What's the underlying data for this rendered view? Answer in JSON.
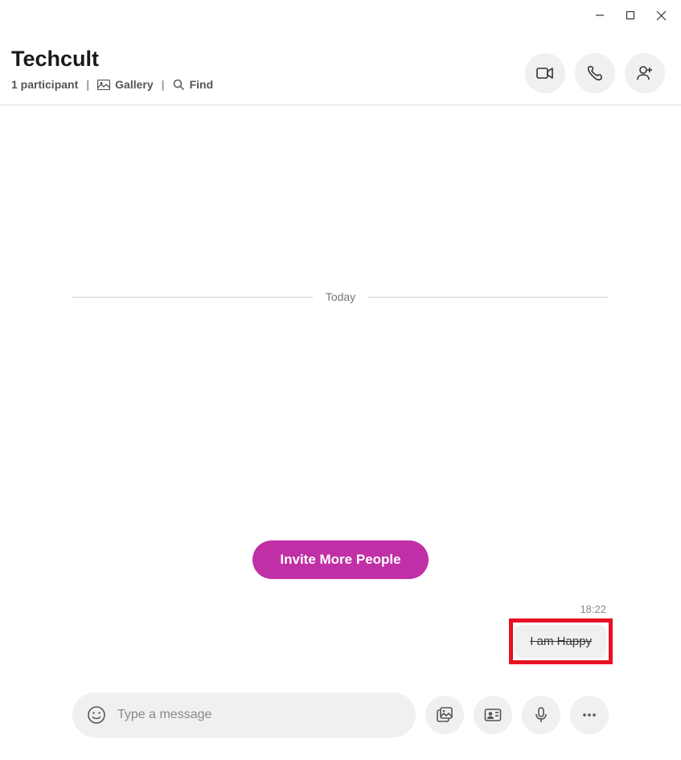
{
  "window": {
    "minimize": "minimize",
    "maximize": "maximize",
    "close": "close"
  },
  "header": {
    "title": "Techcult",
    "participants": "1 participant",
    "gallery": "Gallery",
    "find": "Find"
  },
  "divider": {
    "label": "Today"
  },
  "invite": {
    "label": "Invite More People"
  },
  "message": {
    "time": "18:22",
    "text": "I am Happy"
  },
  "composer": {
    "placeholder": "Type a message"
  },
  "colors": {
    "accent": "#c02fa5",
    "highlight": "#e81123"
  }
}
